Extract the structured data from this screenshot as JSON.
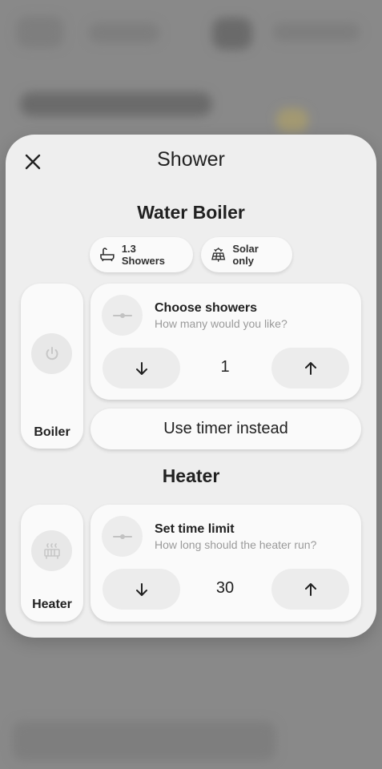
{
  "dialog": {
    "title": "Shower"
  },
  "water_boiler": {
    "title": "Water Boiler",
    "chips": [
      {
        "label": "1.3 Showers",
        "icon": "bathtub-icon"
      },
      {
        "label": "Solar only",
        "icon": "solar-panel-icon"
      }
    ],
    "tile": {
      "label": "Boiler",
      "icon": "power-icon"
    },
    "card": {
      "title": "Choose showers",
      "subtitle": "How many would you like?",
      "value": "1",
      "icon": "slider-icon"
    },
    "timer_button": "Use timer instead"
  },
  "heater": {
    "title": "Heater",
    "tile": {
      "label": "Heater",
      "icon": "radiator-icon"
    },
    "card": {
      "title": "Set time limit",
      "subtitle": "How long should the heater run?",
      "value": "30",
      "icon": "slider-icon"
    }
  }
}
